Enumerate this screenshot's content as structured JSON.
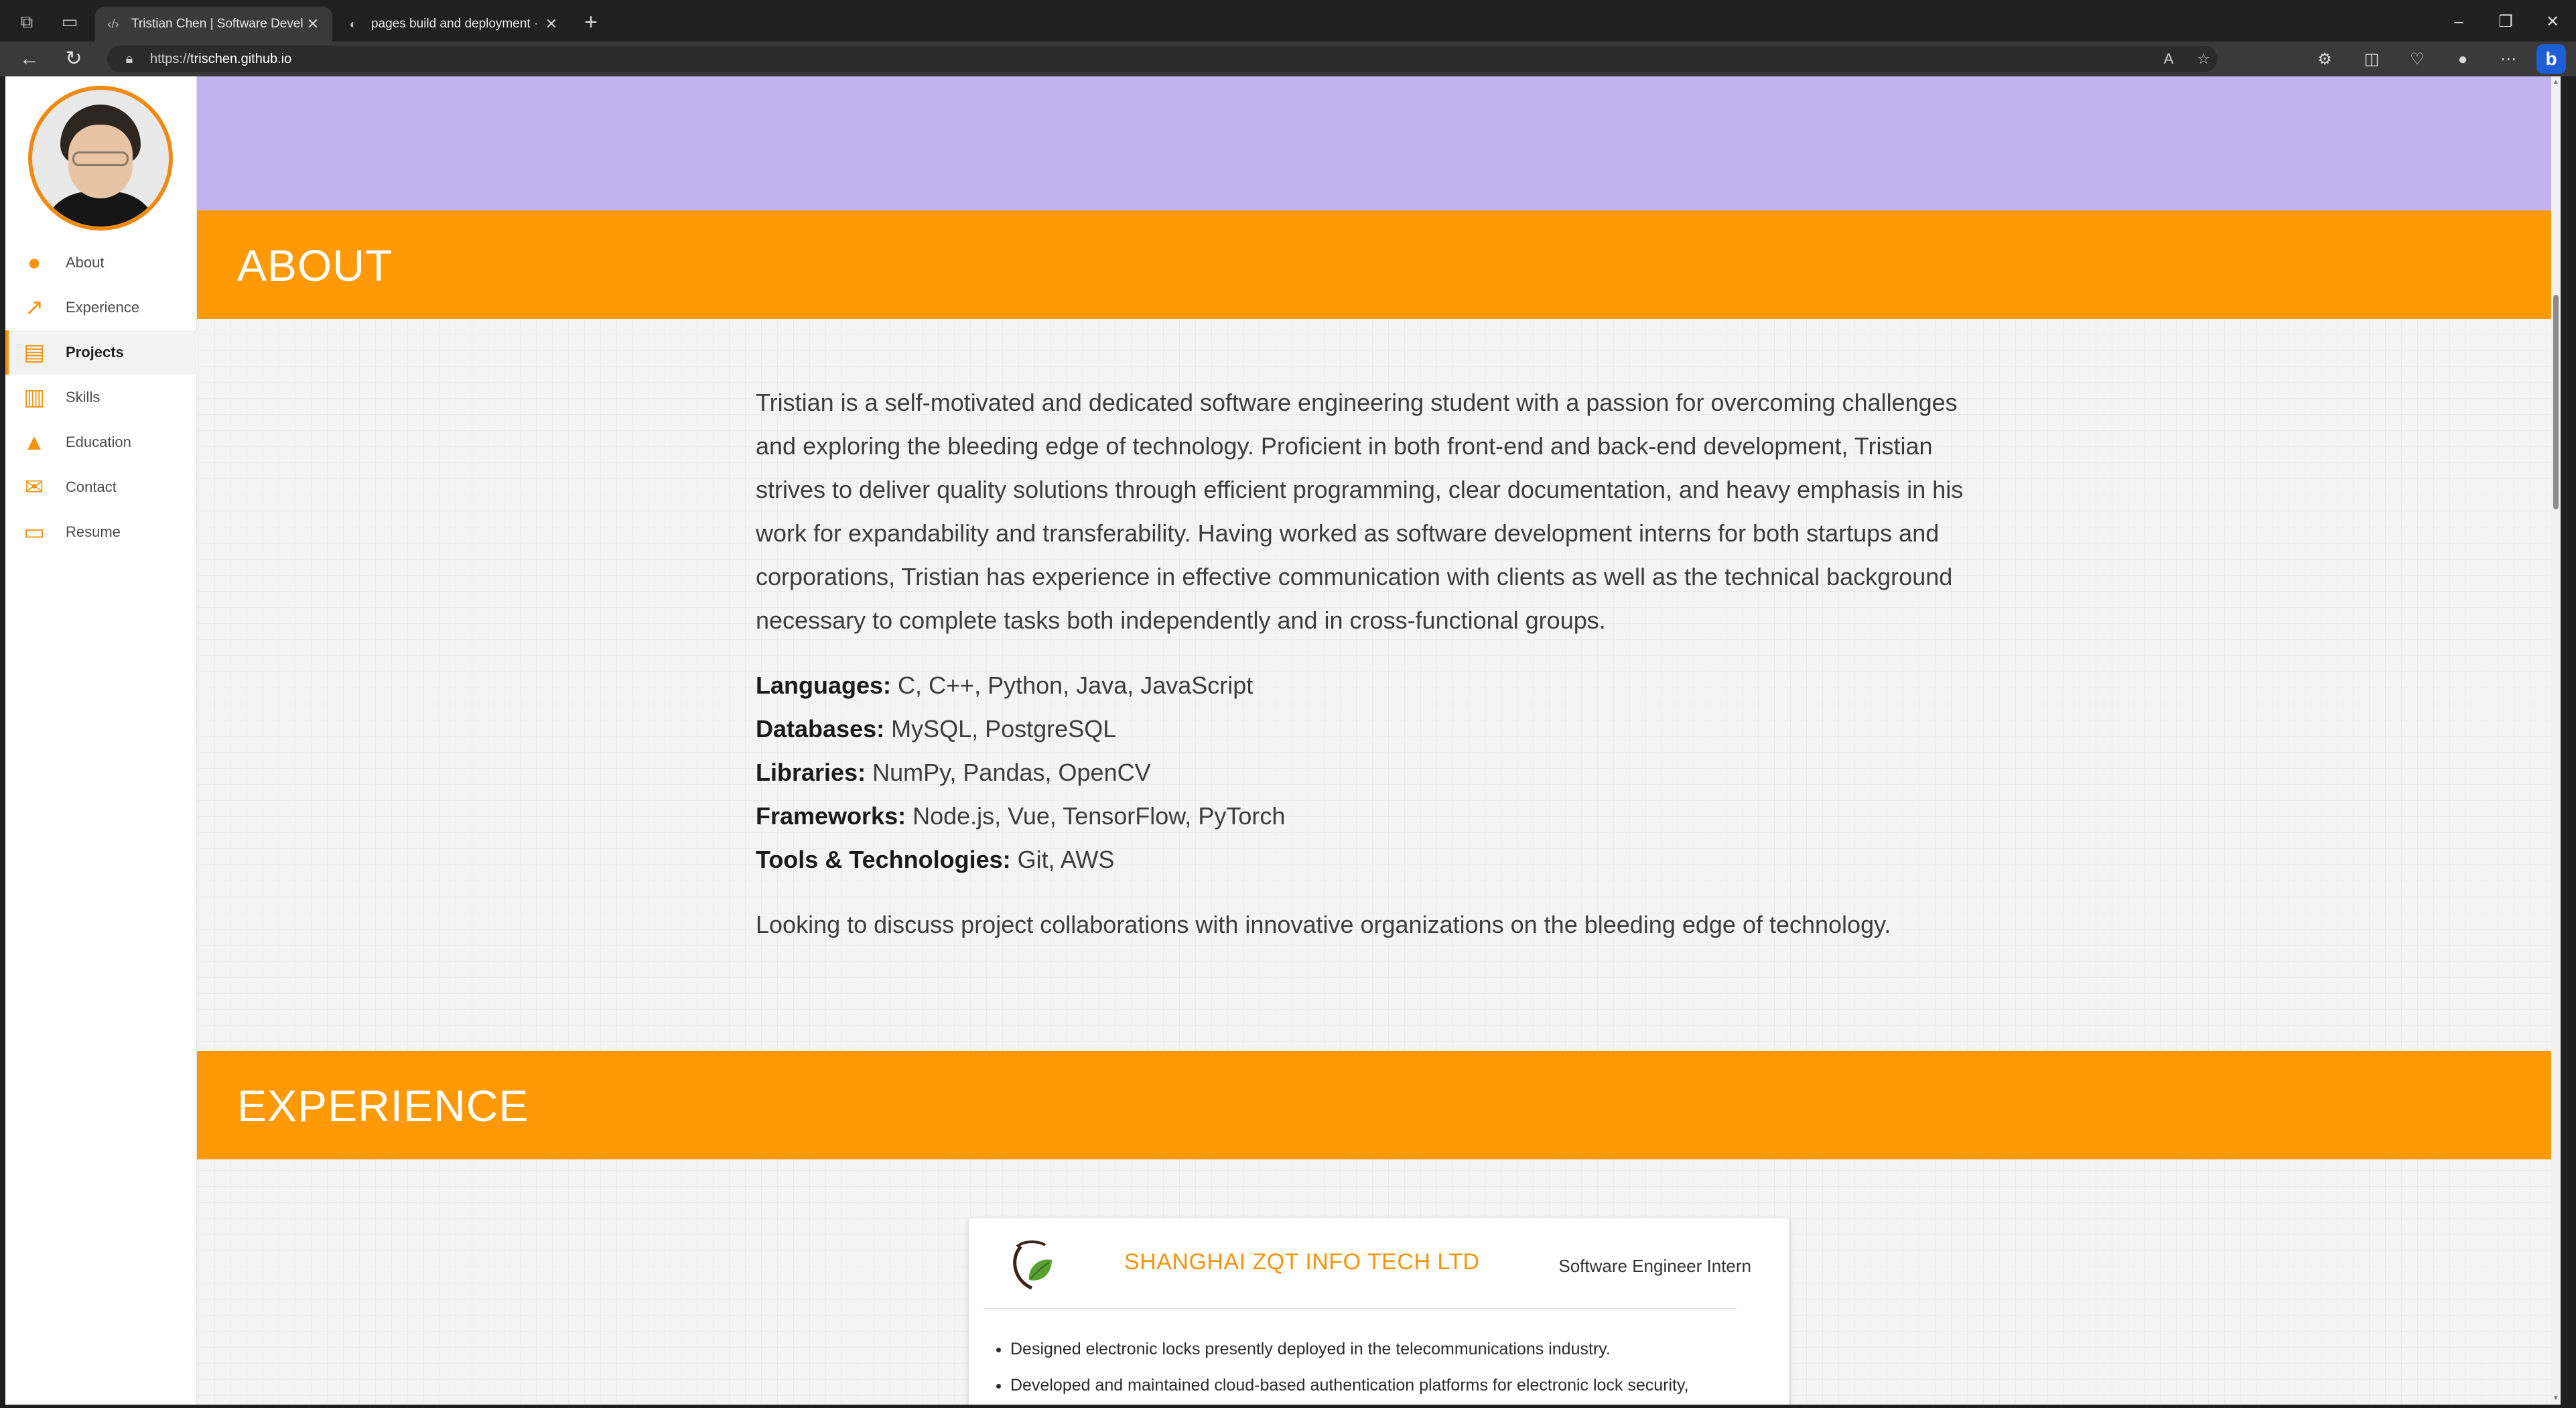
{
  "browser": {
    "tabs": [
      {
        "title": "Tristian Chen | Software Develop",
        "icon": "code-icon",
        "active": true
      },
      {
        "title": "pages build and deployment · Tr",
        "icon": "github-icon",
        "active": false
      }
    ],
    "url_prefix": "https://",
    "url_host": "trischen.github.io"
  },
  "sidebar": {
    "items": [
      {
        "label": "About",
        "icon": "person-icon"
      },
      {
        "label": "Experience",
        "icon": "trending-up-icon"
      },
      {
        "label": "Projects",
        "icon": "library-books-icon",
        "active": true
      },
      {
        "label": "Skills",
        "icon": "bar-chart-icon"
      },
      {
        "label": "Education",
        "icon": "graduation-cap-icon"
      },
      {
        "label": "Contact",
        "icon": "mail-icon"
      },
      {
        "label": "Resume",
        "icon": "folder-icon"
      }
    ]
  },
  "sections": {
    "about_title": "ABOUT",
    "experience_title": "EXPERIENCE"
  },
  "about": {
    "paragraph": "Tristian is a self-motivated and dedicated software engineering student with a passion for overcoming challenges and exploring the bleeding edge of technology. Proficient in both front-end and back-end development, Tristian strives to deliver quality solutions through efficient programming, clear documentation, and heavy emphasis in his work for expandability and transferability. Having worked as software development interns for both startups and corporations, Tristian has experience in effective communication with clients as well as the technical background necessary to complete tasks both independently and in cross-functional groups.",
    "skills": [
      {
        "label": "Languages:",
        "value": " C, C++, Python, Java, JavaScript"
      },
      {
        "label": "Databases:",
        "value": " MySQL, PostgreSQL"
      },
      {
        "label": "Libraries:",
        "value": " NumPy, Pandas, OpenCV"
      },
      {
        "label": "Frameworks:",
        "value": " Node.js, Vue, TensorFlow, PyTorch"
      },
      {
        "label": "Tools & Technologies:",
        "value": " Git, AWS"
      }
    ],
    "closing": "Looking to discuss project collaborations with innovative organizations on the bleeding edge of technology."
  },
  "experience": {
    "company": "SHANGHAI ZQT INFO TECH LTD",
    "role": "Software Engineer Intern",
    "bullets": [
      "Designed electronic locks presently deployed in the telecommunications industry.",
      "Developed and maintained cloud-based authentication platforms for electronic lock security,"
    ]
  },
  "colors": {
    "accent": "#ff9a06",
    "hero": "#c1b3ef",
    "sidebar_icon": "#f5940c"
  }
}
